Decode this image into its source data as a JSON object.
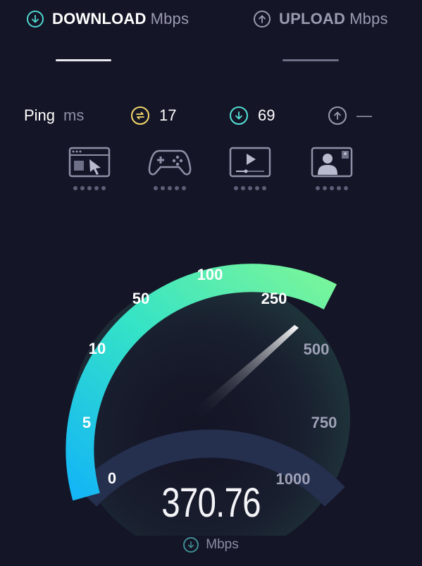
{
  "tabs": {
    "download": {
      "label": "DOWNLOAD",
      "unit": "Mbps",
      "icon": "arrow-down-circle-icon"
    },
    "upload": {
      "label": "UPLOAD",
      "unit": "Mbps",
      "icon": "arrow-up-circle-icon"
    }
  },
  "ping": {
    "label": "Ping",
    "unit": "ms",
    "idle": {
      "value": "17",
      "icon": "swap-arrows-icon",
      "color": "#f5d86c"
    },
    "download": {
      "value": "69",
      "icon": "arrow-down-circle-icon",
      "color": "#55e0d6"
    },
    "upload": {
      "value": "—",
      "icon": "arrow-up-circle-icon",
      "color": "#9a9bb0"
    }
  },
  "activities": [
    {
      "name": "web-browsing",
      "icon": "browser-cursor-icon",
      "rating_dots": 5
    },
    {
      "name": "gaming",
      "icon": "gamepad-icon",
      "rating_dots": 5
    },
    {
      "name": "video-streaming",
      "icon": "video-player-icon",
      "rating_dots": 5
    },
    {
      "name": "video-chat",
      "icon": "video-chat-icon",
      "rating_dots": 5
    }
  ],
  "gauge": {
    "scale_labels": [
      "0",
      "5",
      "10",
      "50",
      "100",
      "250",
      "500",
      "750",
      "1000"
    ],
    "reading": "370.76",
    "unit": "Mbps",
    "unit_icon": "arrow-down-circle-icon",
    "gradient_start": "#14b6f5",
    "gradient_mid": "#35e3c6",
    "gradient_end": "#73f39a",
    "track_color": "#252f4e"
  }
}
